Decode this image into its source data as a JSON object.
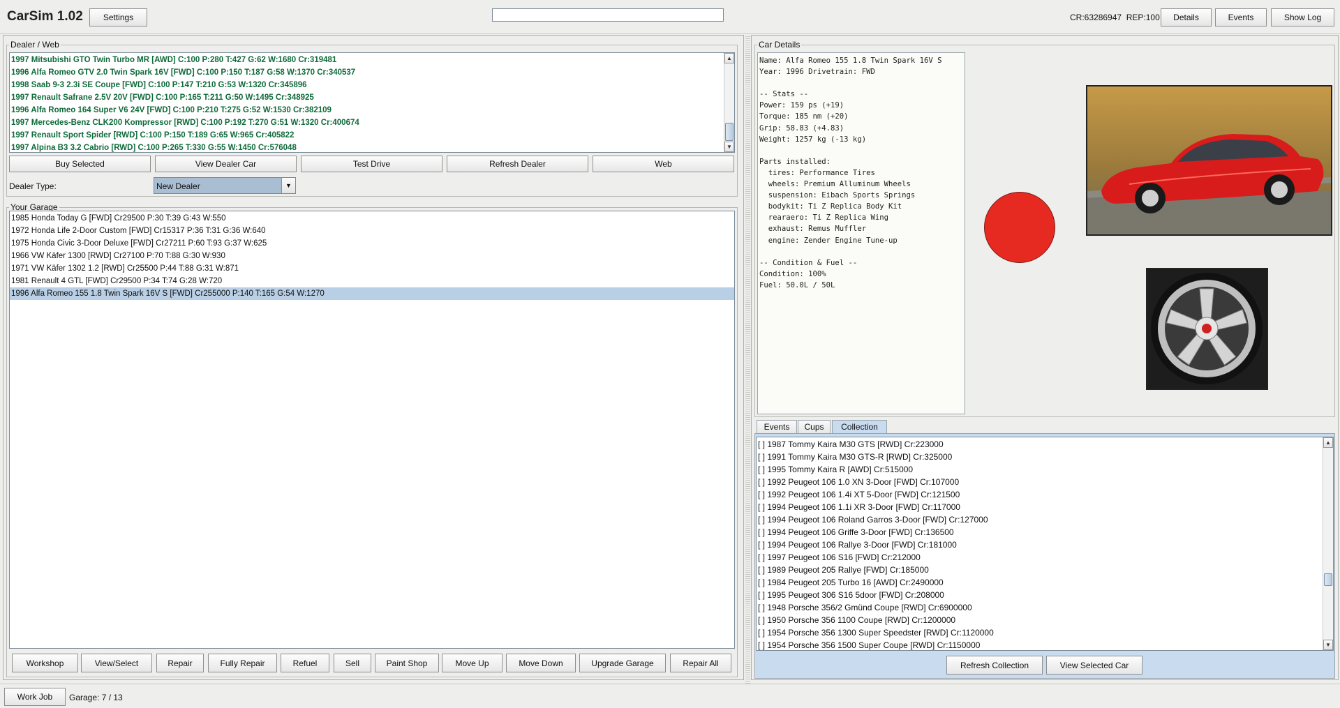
{
  "app": {
    "title": "CarSim 1.02",
    "settings_label": "Settings",
    "search_value": "",
    "credits_rep": "CR:63286947  REP:100",
    "details_label": "Details",
    "events_label": "Events",
    "show_log_label": "Show Log"
  },
  "dealer": {
    "legend": "Dealer / Web",
    "items": [
      "1997 Mitsubishi GTO Twin Turbo MR [AWD] C:100 P:280 T:427 G:62 W:1680 Cr:319481",
      "1996 Alfa Romeo GTV 2.0 Twin Spark 16V [FWD] C:100 P:150 T:187 G:58 W:1370 Cr:340537",
      "1998 Saab 9-3 2.3i SE Coupe [FWD] C:100 P:147 T:210 G:53 W:1320 Cr:345896",
      "1997 Renault Safrane 2.5V 20V [FWD] C:100 P:165 T:211 G:50 W:1495 Cr:348925",
      "1996 Alfa Romeo 164 Super V6 24V [FWD] C:100 P:210 T:275 G:52 W:1530 Cr:382109",
      "1997 Mercedes-Benz CLK200 Kompressor [RWD] C:100 P:192 T:270 G:51 W:1320 Cr:400674",
      "1997 Renault Sport Spider [RWD] C:100 P:150 T:189 G:65 W:965 Cr:405822",
      "1997 Alpina B3 3.2 Cabrio [RWD] C:100 P:265 T:330 G:55 W:1450 Cr:576048"
    ],
    "buttons": [
      "Buy Selected",
      "View Dealer Car",
      "Test Drive",
      "Refresh Dealer",
      "Web"
    ],
    "type_label": "Dealer Type:",
    "type_value": "New Dealer"
  },
  "garage": {
    "legend": "Your Garage",
    "items": [
      "1985 Honda Today G [FWD] Cr29500 P:30 T:39 G:43 W:550",
      "1972 Honda Life 2-Door Custom [FWD] Cr15317 P:36 T:31 G:36 W:640",
      "1975 Honda Civic 3-Door Deluxe [FWD] Cr27211 P:60 T:93 G:37 W:625",
      "1966 VW Käfer 1300 [RWD] Cr27100 P:70 T:88 G:30 W:930",
      "1971 VW Käfer 1302 1.2 [RWD] Cr25500 P:44 T:88 G:31 W:871",
      "1981 Renault 4 GTL [FWD] Cr29500 P:34 T:74 G:28 W:720",
      "1996 Alfa Romeo 155 1.8 Twin Spark 16V S [FWD] Cr255000 P:140 T:165 G:54 W:1270"
    ],
    "selected_index": 6,
    "buttons": [
      "Workshop",
      "View/Select",
      "Repair",
      "Fully Repair",
      "Refuel",
      "Sell",
      "Paint Shop",
      "Move Up",
      "Move Down",
      "Upgrade Garage",
      "Repair All"
    ]
  },
  "car_details": {
    "legend": "Car Details",
    "text": "Name: Alfa Romeo 155 1.8 Twin Spark 16V S\nYear: 1996 Drivetrain: FWD\n\n-- Stats --\nPower: 159 ps (+19)\nTorque: 185 nm (+20)\nGrip: 58.83 (+4.83)\nWeight: 1257 kg (-13 kg)\n\nParts installed:\n  tires: Performance Tires\n  wheels: Premium Alluminum Wheels\n  suspension: Eibach Sports Springs\n  bodykit: Ti Z Replica Body Kit\n  rearaero: Ti Z Replica Wing\n  exhaust: Remus Muffler\n  engine: Zender Engine Tune-up\n\n-- Condition & Fuel --\nCondition: 100%\nFuel: 50.0L / 50L",
    "paint_color": "#e62a22"
  },
  "tabs": {
    "items": [
      "Events",
      "Cups",
      "Collection"
    ],
    "active": "Collection"
  },
  "collection": {
    "items": [
      "[ ] 1987 Tommy Kaira M30 GTS [RWD] Cr:223000",
      "[ ] 1991 Tommy Kaira M30 GTS-R [RWD] Cr:325000",
      "[ ] 1995 Tommy Kaira R [AWD] Cr:515000",
      "[ ] 1992 Peugeot 106 1.0 XN 3-Door [FWD] Cr:107000",
      "[ ] 1992 Peugeot 106 1.4i XT 5-Door [FWD] Cr:121500",
      "[ ] 1994 Peugeot 106 1.1i XR 3-Door [FWD] Cr:117000",
      "[ ] 1994 Peugeot 106 Roland Garros 3-Door [FWD] Cr:127000",
      "[ ] 1994 Peugeot 106 Griffe 3-Door [FWD] Cr:136500",
      "[ ] 1994 Peugeot 106 Rallye 3-Door [FWD] Cr:181000",
      "[ ] 1997 Peugeot 106 S16 [FWD] Cr:212000",
      "[ ] 1989 Peugeot 205 Rallye [FWD] Cr:185000",
      "[ ] 1984 Peugeot 205 Turbo 16 [AWD] Cr:2490000",
      "[ ] 1995 Peugeot 306 S16 5door [FWD] Cr:208000",
      "[ ] 1948 Porsche 356/2 Gmünd Coupe [RWD] Cr:6900000",
      "[ ] 1950 Porsche 356 1100 Coupe [RWD] Cr:1200000",
      "[ ] 1954 Porsche 356 1300 Super Speedster [RWD] Cr:1120000",
      "[ ] 1954 Porsche 356 1500 Super Coupe [RWD] Cr:1150000"
    ],
    "refresh_label": "Refresh Collection",
    "view_label": "View Selected Car"
  },
  "footer": {
    "work_job_label": "Work Job",
    "garage_count": "Garage: 7 / 13"
  }
}
